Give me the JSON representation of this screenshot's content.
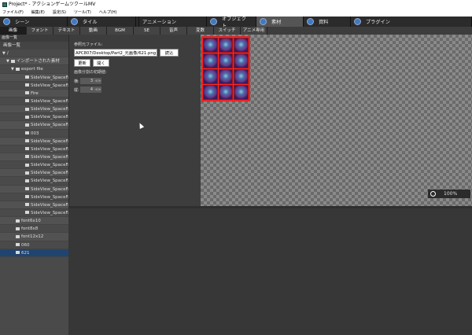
{
  "window": {
    "title": "Project* - アクションゲームツクールMV"
  },
  "menu": [
    "ファイル(F)",
    "編集(E)",
    "設定(S)",
    "ツール(T)",
    "ヘルプ(H)"
  ],
  "ribbon": [
    "シーン",
    "タイル",
    "アニメーション",
    "オブジェクト",
    "素材",
    "資料",
    "プラグイン"
  ],
  "ribbon_active": "素材",
  "subtabs": [
    "画像",
    "フォント",
    "テキスト",
    "動画",
    "BGM",
    "SE",
    "音声",
    "変数",
    "スイッチ",
    "アニメ専用"
  ],
  "sidebar": {
    "header": "画像一覧",
    "list_title": "画像一覧",
    "items": [
      {
        "label": "/",
        "type": "root"
      },
      {
        "label": "インポートされた素材",
        "type": "folder"
      },
      {
        "label": "export file",
        "type": "folder"
      },
      {
        "label": "SideView_SpaceFa",
        "type": "file"
      },
      {
        "label": "SideView_SpaceFa",
        "type": "file"
      },
      {
        "label": "Fire",
        "type": "file"
      },
      {
        "label": "SideView_SpaceFa",
        "type": "file"
      },
      {
        "label": "SideView_SpaceFa",
        "type": "file"
      },
      {
        "label": "SideView_SpaceFa",
        "type": "file"
      },
      {
        "label": "SideView_SpaceFa",
        "type": "file"
      },
      {
        "label": "003",
        "type": "file"
      },
      {
        "label": "SideView_SpaceFa",
        "type": "file"
      },
      {
        "label": "SideView_SpaceFa",
        "type": "file"
      },
      {
        "label": "SideView_SpaceFa",
        "type": "file"
      },
      {
        "label": "SideView_SpaceFa",
        "type": "file"
      },
      {
        "label": "SideView_SpaceFa",
        "type": "file"
      },
      {
        "label": "SideView_SpaceFa",
        "type": "file"
      },
      {
        "label": "SideView_SpaceFa",
        "type": "file"
      },
      {
        "label": "SideView_SpaceFa",
        "type": "file"
      },
      {
        "label": "SideView_SpaceFa",
        "type": "file"
      },
      {
        "label": "SideView_SpaceFa",
        "type": "file"
      },
      {
        "label": "font6x10",
        "type": "file"
      },
      {
        "label": "font8x8",
        "type": "file"
      },
      {
        "label": "font12x12",
        "type": "file"
      },
      {
        "label": "060",
        "type": "file"
      },
      {
        "label": "621",
        "type": "file",
        "selected": true
      }
    ]
  },
  "panel": {
    "ref_file_label": "参照元ファイル:",
    "path_value": "APC807/Desktop/Part2_元画像/621.png",
    "load_button": "読込",
    "update_button": "更新",
    "open_button": "開く",
    "split_label": "画像分割の初期値:",
    "h_label": "横:",
    "h_value": "3",
    "v_label": "縦:",
    "v_value": "4"
  },
  "preview": {
    "zoom": "100%",
    "grid_cols": 3,
    "grid_rows": 4
  }
}
